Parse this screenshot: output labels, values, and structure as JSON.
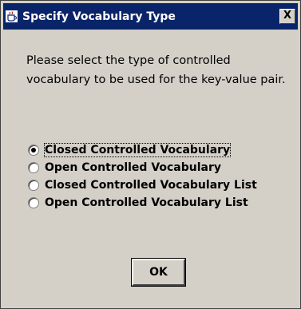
{
  "dialog": {
    "title": "Specify Vocabulary Type",
    "close_glyph": "X",
    "message": "Please select the type of controlled vocabulary to be used for the key-value pair.",
    "options": [
      {
        "label": "Closed Controlled Vocabulary",
        "selected": true
      },
      {
        "label": "Open Controlled Vocabulary",
        "selected": false
      },
      {
        "label": "Closed Controlled Vocabulary List",
        "selected": false
      },
      {
        "label": "Open Controlled Vocabulary List",
        "selected": false
      }
    ],
    "ok_label": "OK",
    "title_icon": "java-cup-icon"
  },
  "colors": {
    "titlebar": "#0a246a",
    "window_bg": "#d4d0c8"
  }
}
